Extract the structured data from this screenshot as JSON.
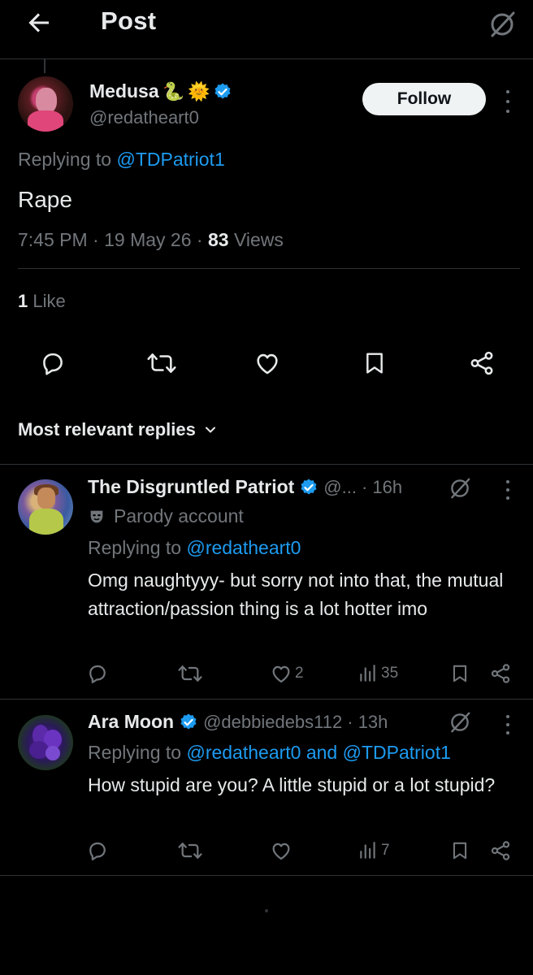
{
  "header": {
    "title": "Post",
    "back_icon": "arrow-left-icon",
    "grok_icon": "grok-icon"
  },
  "main_post": {
    "display_name": "Medusa",
    "emoji_badges": [
      "🐍",
      "🌞"
    ],
    "handle": "@redatheart0",
    "follow_label": "Follow",
    "replying_prefix": "Replying to",
    "replying_to": "@TDPatriot1",
    "text": "Rape",
    "time": "7:45 PM",
    "date": "19 May 26",
    "views_count": "83",
    "views_label": "Views",
    "likes_count": "1",
    "likes_label": "Like"
  },
  "sort": {
    "label": "Most relevant replies"
  },
  "replies": [
    {
      "display_name": "The Disgruntled Patriot",
      "handle": "@...",
      "time": "· 16h",
      "parody_label": "Parody account",
      "replying_prefix": "Replying to",
      "replying_to": "@redatheart0",
      "text": "Omg naughtyyy- but sorry not into that, the mutual attraction/passion thing is a lot hotter imo",
      "likes": "2",
      "views": "35"
    },
    {
      "display_name": "Ara Moon",
      "handle": "@debbiedebs112",
      "time": "· 13h",
      "replying_prefix": "Replying to",
      "replying_to": "@redatheart0 and @TDPatriot1",
      "text": "How stupid are you? A little stupid or a lot stupid?",
      "likes": "",
      "views": "7"
    }
  ],
  "colors": {
    "background": "#000000",
    "text": "#e7e9ea",
    "muted": "#71767b",
    "link": "#1d9bf0",
    "verified": "#1d9bf0"
  }
}
